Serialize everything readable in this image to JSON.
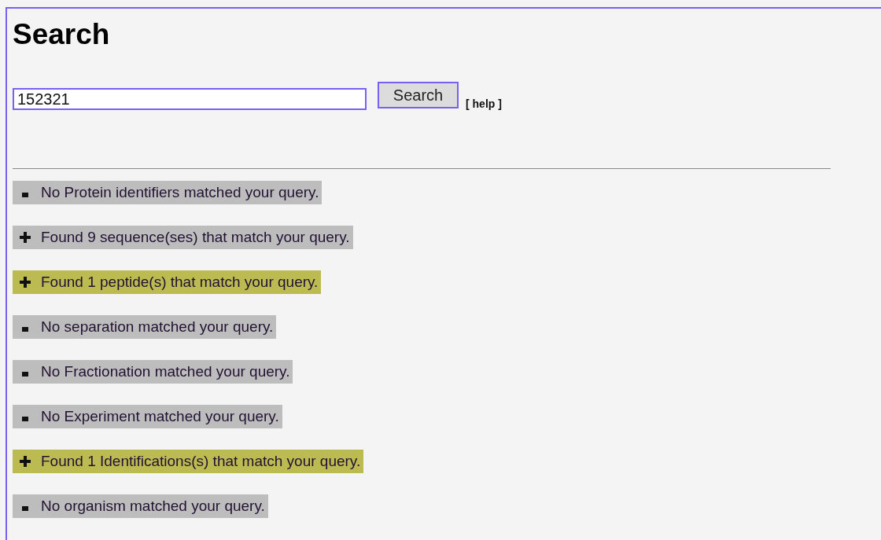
{
  "heading": "Search",
  "search": {
    "value": "152321",
    "button": "Search",
    "help": "[ help ]"
  },
  "results": [
    {
      "kind": "none",
      "text": "No Protein identifiers matched your query.",
      "color": "#bdbdbd"
    },
    {
      "kind": "found",
      "text": "Found 9 sequence(ses) that match your query.",
      "color": "#bdbdbd"
    },
    {
      "kind": "found",
      "text": "Found 1 peptide(s) that match your query.",
      "color": "#bcbb52"
    },
    {
      "kind": "none",
      "text": "No separation matched your query.",
      "color": "#bdbdbd"
    },
    {
      "kind": "none",
      "text": "No Fractionation matched your query.",
      "color": "#bdbdbd"
    },
    {
      "kind": "none",
      "text": "No Experiment matched your query.",
      "color": "#bdbdbd"
    },
    {
      "kind": "found",
      "text": "Found 1 Identifications(s) that match your query.",
      "color": "#bcbb52"
    },
    {
      "kind": "none",
      "text": "No organism matched your query.",
      "color": "#bdbdbd"
    }
  ]
}
